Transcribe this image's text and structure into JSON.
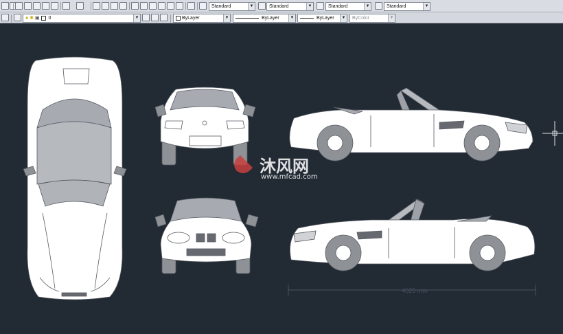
{
  "toolbar_top": {
    "text_style": "Standard",
    "dim_style": "Standard",
    "table_style": "Standard",
    "multileader_style": "Standard"
  },
  "layer_bar": {
    "current_layer": "0",
    "color": "ByLayer",
    "linetype": "ByLayer",
    "lineweight": "ByLayer",
    "plot_style": "ByColor"
  },
  "drawing": {
    "watermark_text": "沐风网",
    "watermark_url": "www.mfcad.com",
    "dimension_text": "4025 mm"
  },
  "colors": {
    "canvas": "#222a34",
    "body": "#ffffff",
    "glass": "#b3b6bb",
    "tire": "#8e9296",
    "accent": "#c8403e"
  }
}
